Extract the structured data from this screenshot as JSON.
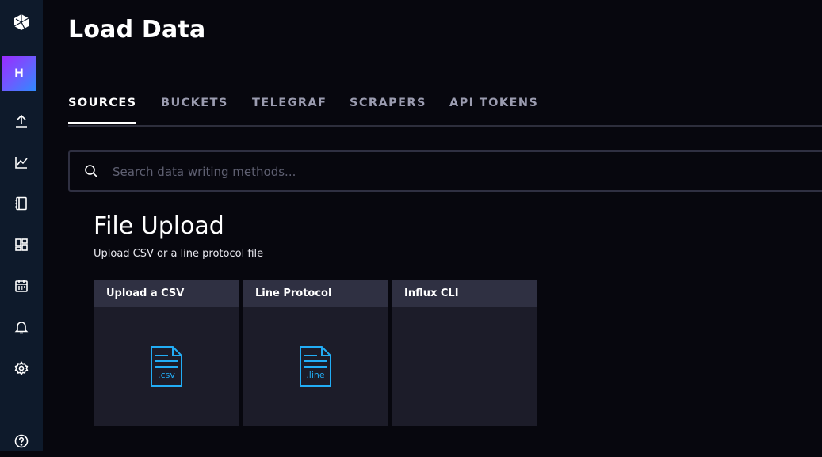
{
  "sidebar": {
    "avatar_letter": "H",
    "icons": [
      "logo-icon",
      "upload-icon",
      "chart-icon",
      "notebook-icon",
      "dashboard-icon",
      "calendar-icon",
      "bell-icon",
      "gear-icon",
      "help-icon"
    ]
  },
  "page": {
    "title": "Load Data"
  },
  "tabs": [
    {
      "label": "SOURCES",
      "active": true
    },
    {
      "label": "BUCKETS",
      "active": false
    },
    {
      "label": "TELEGRAF",
      "active": false
    },
    {
      "label": "SCRAPERS",
      "active": false
    },
    {
      "label": "API TOKENS",
      "active": false
    }
  ],
  "search": {
    "placeholder": "Search data writing methods..."
  },
  "file_upload": {
    "title": "File Upload",
    "description": "Upload CSV or a line protocol file",
    "cards": [
      {
        "title": "Upload a CSV",
        "ext": ".csv"
      },
      {
        "title": "Line Protocol",
        "ext": ".line"
      },
      {
        "title": "Influx CLI",
        "ext": ""
      }
    ]
  },
  "colors": {
    "accent": "#22adf6",
    "card_bg": "#1c1c29",
    "card_header": "#2f3042",
    "sidebar_bg": "#0e1a2b"
  }
}
